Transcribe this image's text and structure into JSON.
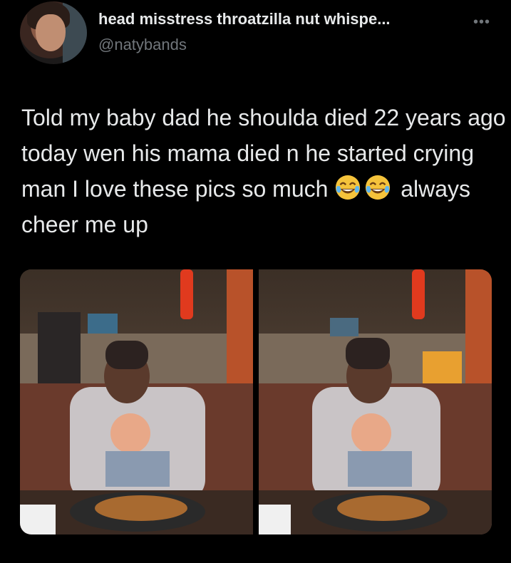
{
  "tweet": {
    "display_name": "head misstress throatzilla nut whispe...",
    "handle": "@natybands",
    "more_icon": "ellipsis-icon",
    "text_before_emoji": "Told my baby dad he shoulda died 22 years ago today wen his mama died n he started crying man I love these pics so much",
    "emoji": [
      "face-with-tears-of-joy",
      "face-with-tears-of-joy"
    ],
    "text_after_emoji": "always cheer me up",
    "media_count": 2
  },
  "colors": {
    "background": "#000000",
    "text": "#e7e9ea",
    "secondary_text": "#71767b"
  }
}
